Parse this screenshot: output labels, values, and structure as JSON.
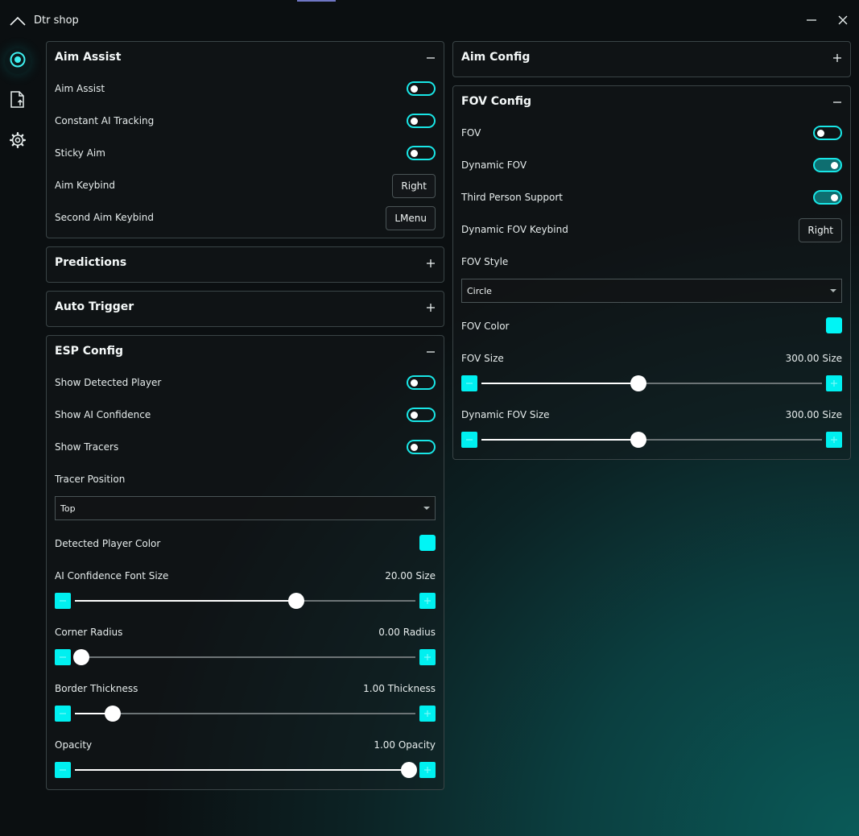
{
  "app": {
    "title": "Dtr shop"
  },
  "sidebar": {
    "items": [
      {
        "icon": "crosshair-icon",
        "active": true
      },
      {
        "icon": "file-upload-icon",
        "active": false
      },
      {
        "icon": "gear-icon",
        "active": false
      }
    ]
  },
  "colors": {
    "accent": "#00f0f0",
    "swatch": "#00f5f5"
  },
  "panels": {
    "aim_assist": {
      "title": "Aim Assist",
      "expanded": true,
      "aim_assist": {
        "label": "Aim Assist",
        "on": false
      },
      "constant_ai_tracking": {
        "label": "Constant AI Tracking",
        "on": false
      },
      "sticky_aim": {
        "label": "Sticky Aim",
        "on": false
      },
      "aim_keybind": {
        "label": "Aim Keybind",
        "value": "Right"
      },
      "second_aim_keybind": {
        "label": "Second Aim Keybind",
        "value": "LMenu"
      }
    },
    "predictions": {
      "title": "Predictions",
      "expanded": false
    },
    "auto_trigger": {
      "title": "Auto Trigger",
      "expanded": false
    },
    "esp_config": {
      "title": "ESP Config",
      "expanded": true,
      "show_detected_player": {
        "label": "Show Detected Player",
        "on": false
      },
      "show_ai_confidence": {
        "label": "Show AI Confidence",
        "on": false
      },
      "show_tracers": {
        "label": "Show Tracers",
        "on": false
      },
      "tracer_position": {
        "label": "Tracer Position",
        "value": "Top"
      },
      "detected_player_color": {
        "label": "Detected Player Color",
        "color": "#00f5f5"
      },
      "ai_confidence_font_size": {
        "label": "AI Confidence Font Size",
        "display": "20.00 Size",
        "fraction": 0.65
      },
      "corner_radius": {
        "label": "Corner Radius",
        "display": "0.00 Radius",
        "fraction": 0.02
      },
      "border_thickness": {
        "label": "Border Thickness",
        "display": "1.00 Thickness",
        "fraction": 0.11
      },
      "opacity": {
        "label": "Opacity",
        "display": "1.00 Opacity",
        "fraction": 0.98
      }
    },
    "aim_config": {
      "title": "Aim Config",
      "expanded": false
    },
    "fov_config": {
      "title": "FOV Config",
      "expanded": true,
      "fov": {
        "label": "FOV",
        "on": false
      },
      "dynamic_fov": {
        "label": "Dynamic FOV",
        "on": true
      },
      "third_person_support": {
        "label": "Third Person Support",
        "on": true
      },
      "dynamic_fov_keybind": {
        "label": "Dynamic FOV Keybind",
        "value": "Right"
      },
      "fov_style": {
        "label": "FOV Style",
        "value": "Circle"
      },
      "fov_color": {
        "label": "FOV Color",
        "color": "#00f5f5"
      },
      "fov_size": {
        "label": "FOV Size",
        "display": "300.00 Size",
        "fraction": 0.46
      },
      "dynamic_fov_size": {
        "label": "Dynamic FOV Size",
        "display": "300.00 Size",
        "fraction": 0.46
      }
    }
  }
}
